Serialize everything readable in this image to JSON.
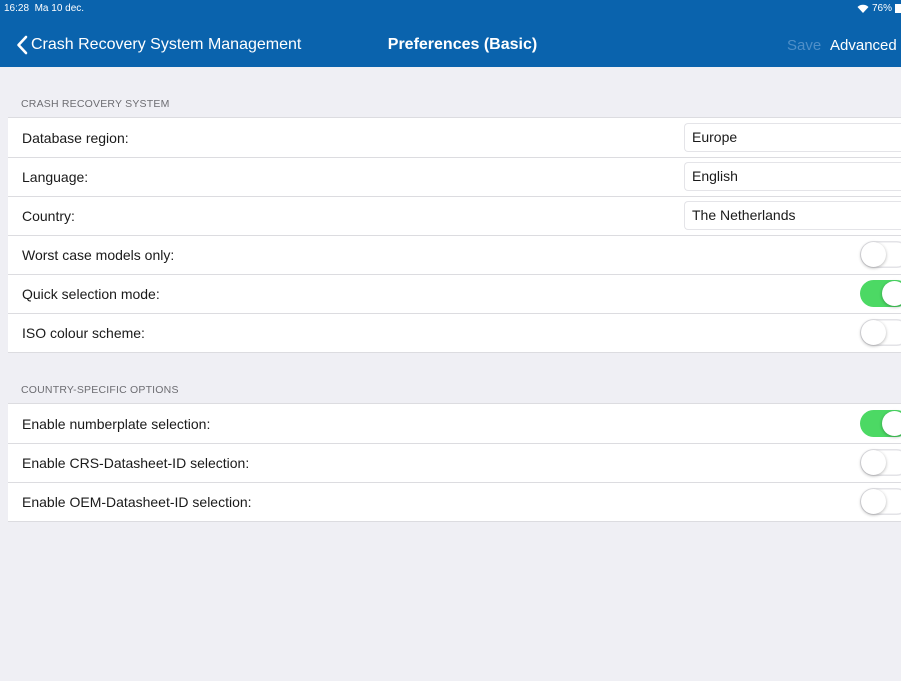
{
  "status_bar": {
    "time": "16:28",
    "date": "Ma 10 dec.",
    "battery": "76%"
  },
  "nav": {
    "back_label": "Crash Recovery System Management",
    "title": "Preferences (Basic)",
    "save_label": "Save",
    "advanced_label": "Advanced"
  },
  "sections": {
    "crs": {
      "header": "CRASH RECOVERY SYSTEM",
      "database_region": {
        "label": "Database region:",
        "value": "Europe"
      },
      "language": {
        "label": "Language:",
        "value": "English"
      },
      "country": {
        "label": "Country:",
        "value": "The Netherlands"
      },
      "worst_case": {
        "label": "Worst case models only:",
        "on": false
      },
      "quick_selection": {
        "label": "Quick selection mode:",
        "on": true
      },
      "iso_colour": {
        "label": "ISO colour scheme:",
        "on": false
      }
    },
    "country_options": {
      "header": "COUNTRY-SPECIFIC OPTIONS",
      "numberplate": {
        "label": "Enable numberplate selection:",
        "on": true
      },
      "crs_datasheet": {
        "label": "Enable CRS-Datasheet-ID selection:",
        "on": false
      },
      "oem_datasheet": {
        "label": "Enable OEM-Datasheet-ID selection:",
        "on": false
      }
    }
  },
  "colors": {
    "nav_bar": "#0a63ad",
    "toggle_on": "#4cd964",
    "background": "#efeff4"
  },
  "icons": {
    "back": "chevron-left-icon",
    "wifi": "wifi-icon",
    "battery": "battery-icon"
  }
}
